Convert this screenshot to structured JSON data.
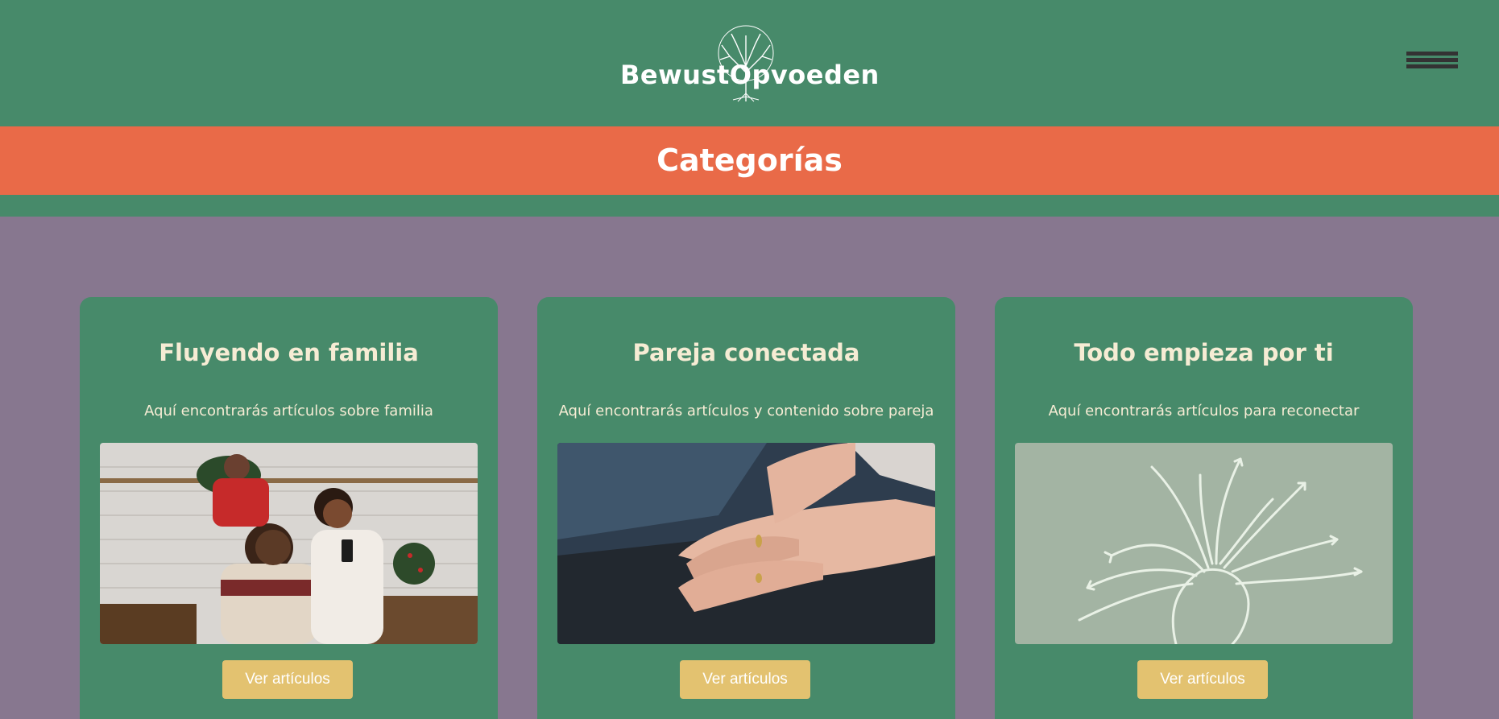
{
  "header": {
    "logo_text": "BewustOpvoeden",
    "menu_icon": "hamburger-icon"
  },
  "banner": {
    "title": "Categorías"
  },
  "colors": {
    "header_bg": "#478a6a",
    "banner_bg": "#e96a48",
    "page_bg": "#87778f",
    "card_bg": "#478a6a",
    "button_bg": "#e3c270",
    "card_text": "#f6ecd4"
  },
  "cards": [
    {
      "title": "Fluyendo en familia",
      "description": "Aquí encontrarás artículos sobre familia",
      "button_label": "Ver artículos"
    },
    {
      "title": "Pareja conectada",
      "description": "Aquí encontrarás artículos y contenido sobre pareja",
      "button_label": "Ver artículos"
    },
    {
      "title": "Todo empieza por ti",
      "description": "Aquí encontrarás artículos para reconectar",
      "button_label": "Ver artículos"
    }
  ]
}
